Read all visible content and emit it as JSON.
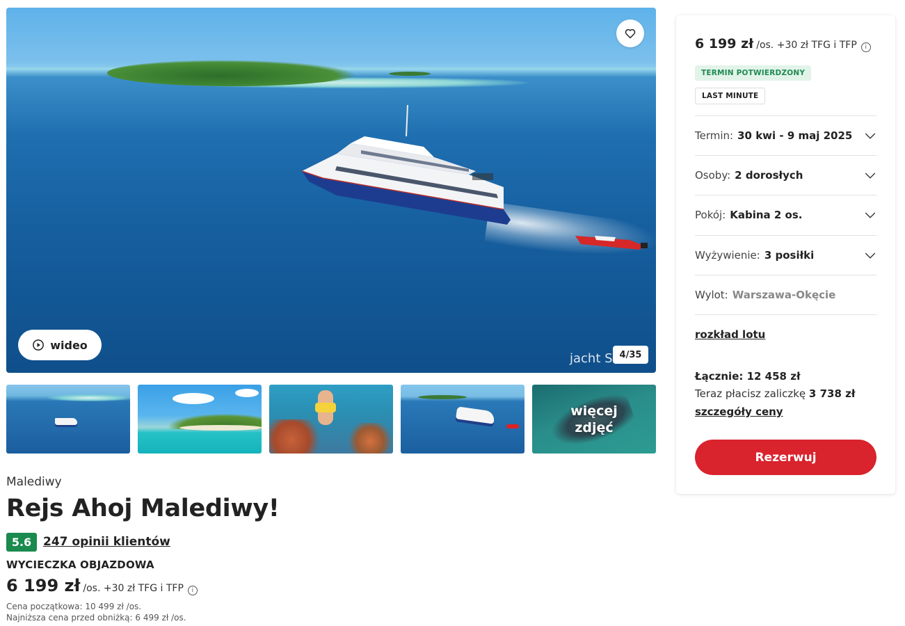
{
  "gallery": {
    "video_label": "wideo",
    "counter": "4/35",
    "watermark": "jacht Sh",
    "more_photos_line1": "więcej",
    "more_photos_line2": "zdjęć"
  },
  "offer": {
    "country": "Malediwy",
    "title": "Rejs Ahoj Malediwy!",
    "rating": "5.6",
    "reviews_link": "247 opinii klientów",
    "trip_type": "WYCIECZKA OBJAZDOWA",
    "price": "6 199 zł",
    "price_suffix": "/os. +30 zł TFG i TFP",
    "initial_price": "Cena początkowa: 10 499 zł /os.",
    "lowest_price": "Najniższa cena przed obniżką: 6 499 zł /os."
  },
  "booking": {
    "price": "6 199 zł",
    "price_suffix": "/os. +30 zł TFG i TFP",
    "tag_confirmed": "TERMIN POTWIERDZONY",
    "tag_last_minute": "LAST MINUTE",
    "options": [
      {
        "label": "Termin:",
        "value": "30 kwi - 9 maj 2025"
      },
      {
        "label": "Osoby:",
        "value": "2 dorosłych"
      },
      {
        "label": "Pokój:",
        "value": "Kabina 2 os."
      },
      {
        "label": "Wyżywienie:",
        "value": "3 posiłki"
      },
      {
        "label": "Wylot:",
        "value": "Warszawa-Okęcie"
      }
    ],
    "flight_schedule_link": "rozkład lotu",
    "total": "Łącznie: 12 458 zł",
    "deposit_prefix": "Teraz płacisz zaliczkę",
    "deposit_amount": "3 738 zł",
    "price_details_link": "szczegóły ceny",
    "book_button": "Rezerwuj"
  },
  "colors": {
    "accent_red": "#d9232d",
    "rating_green": "#1a8a4e",
    "tag_green_bg": "#e2f4e9",
    "tag_green_text": "#1f8a51"
  },
  "icons": {
    "favorite": "heart-icon",
    "video": "play-icon",
    "info": "info-icon",
    "dropdown": "chevron-down-icon"
  }
}
